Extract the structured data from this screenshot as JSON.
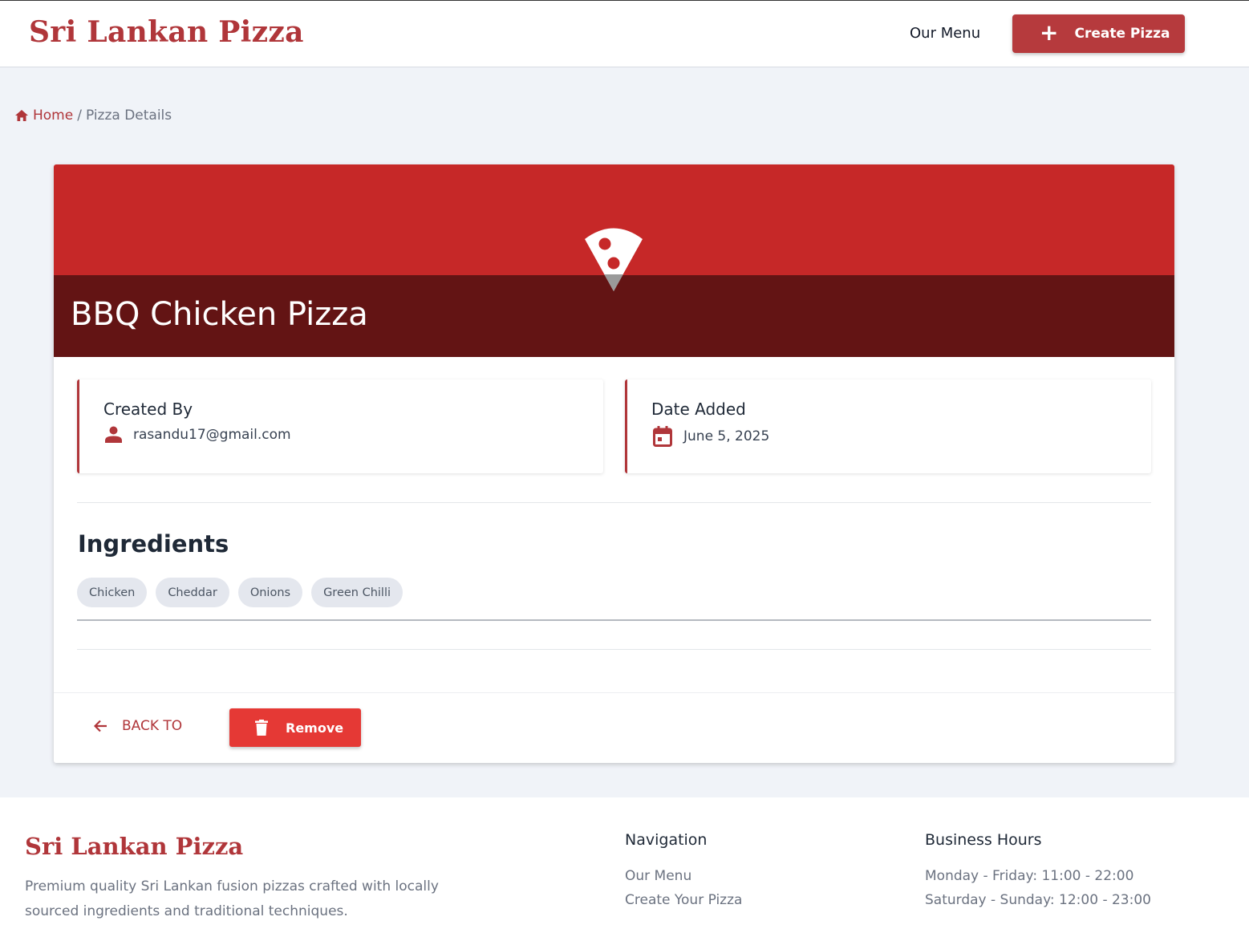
{
  "header": {
    "brand": "Sri Lankan Pizza",
    "nav_menu": "Our Menu",
    "create_button": "Create Pizza"
  },
  "breadcrumb": {
    "home": "Home",
    "separator": "/",
    "current": "Pizza Details"
  },
  "pizza": {
    "name": "BBQ Chicken Pizza",
    "created_by_label": "Created By",
    "created_by": "rasandu17@gmail.com",
    "date_added_label": "Date Added",
    "date_added": "June 5, 2025",
    "ingredients_title": "Ingredients",
    "ingredients": [
      "Chicken",
      "Cheddar",
      "Onions",
      "Green Chilli"
    ]
  },
  "actions": {
    "back": "BACK TO",
    "remove": "Remove"
  },
  "footer": {
    "brand": "Sri Lankan Pizza",
    "description": "Premium quality Sri Lankan fusion pizzas crafted with locally sourced ingredients and traditional techniques.",
    "navigation_title": "Navigation",
    "navigation_links": [
      "Our Menu",
      "Create Your Pizza"
    ],
    "hours_title": "Business Hours",
    "hours": [
      "Monday - Friday: 11:00 - 22:00",
      "Saturday - Sunday: 12:00 - 23:00"
    ]
  },
  "icons": {
    "home": "home-icon",
    "plus": "plus-icon",
    "pizza": "pizza-slice-icon",
    "person": "person-icon",
    "calendar": "calendar-icon",
    "back_arrow": "arrow-left-icon",
    "trash": "trash-icon"
  },
  "colors": {
    "brand": "#b0363a",
    "hero_red": "#c62828",
    "hero_dark": "#631414",
    "remove_red": "#e53935",
    "page_bg": "#f0f3f8"
  }
}
